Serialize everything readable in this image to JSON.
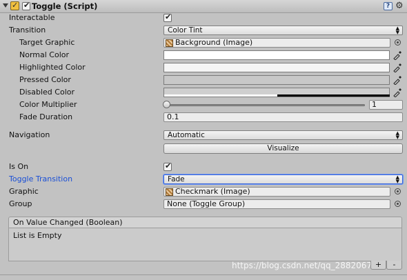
{
  "component": {
    "title": "Toggle (Script)",
    "enabled": true
  },
  "fields": {
    "interactable": {
      "label": "Interactable",
      "checked": true
    },
    "transition": {
      "label": "Transition",
      "value": "Color Tint"
    },
    "target_graphic": {
      "label": "Target Graphic",
      "value": "Background (Image)"
    },
    "normal_color": {
      "label": "Normal Color",
      "color": "#ffffff"
    },
    "highlighted_color": {
      "label": "Highlighted Color",
      "color": "#f5f5f5"
    },
    "pressed_color": {
      "label": "Pressed Color",
      "color": "#c8c8c8"
    },
    "disabled_color": {
      "label": "Disabled Color",
      "color": "#c8c8c8"
    },
    "color_multiplier": {
      "label": "Color Multiplier",
      "value": "1",
      "slider_fraction": 0.0
    },
    "fade_duration": {
      "label": "Fade Duration",
      "value": "0.1"
    },
    "navigation": {
      "label": "Navigation",
      "value": "Automatic"
    },
    "visualize": {
      "label": "Visualize"
    },
    "is_on": {
      "label": "Is On",
      "checked": true
    },
    "toggle_transition": {
      "label": "Toggle Transition",
      "value": "Fade"
    },
    "graphic": {
      "label": "Graphic",
      "value": "Checkmark (Image)"
    },
    "group": {
      "label": "Group",
      "value": "None (Toggle Group)"
    }
  },
  "event": {
    "header": "On Value Changed (Boolean)",
    "empty_text": "List is Empty",
    "add_label": "+",
    "remove_label": "-"
  },
  "watermark": "https://blog.csdn.net/qq_28820675",
  "icons": {
    "help": "help-icon",
    "gear": "gear-icon",
    "eyedropper": "eyedropper-icon",
    "object": "image-object-icon",
    "target": "object-picker-icon"
  }
}
